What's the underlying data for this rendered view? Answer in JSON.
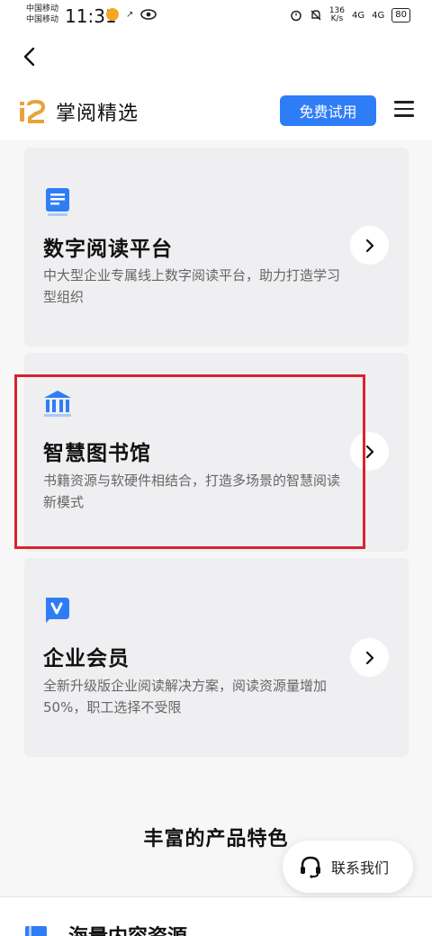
{
  "status_bar": {
    "carrier_1": "中国移动",
    "carrier_2": "中国移动",
    "time": "11:31",
    "net_speed_value": "136",
    "net_speed_unit": "K/s",
    "signal_1": "4G",
    "signal_2": "4G",
    "battery": "80"
  },
  "header": {
    "brand": "掌阅精选",
    "trial_button": "免费试用"
  },
  "cards": [
    {
      "title": "数字阅读平台",
      "description": "中大型企业专属线上数字阅读平台，助力打造学习型组织",
      "icon": "document-icon"
    },
    {
      "title": "智慧图书馆",
      "description": "书籍资源与软硬件相结合，打造多场景的智慧阅读新模式",
      "icon": "library-icon"
    },
    {
      "title": "企业会员",
      "description": "全新升级版企业阅读解决方案，阅读资源量增加50%，职工选择不受限",
      "icon": "vip-icon"
    }
  ],
  "section_title": "丰富的产品特色",
  "contact_button": "联系我们",
  "bottom_card": {
    "title": "海量内容资源"
  },
  "colors": {
    "accent": "#2f7df6",
    "highlight": "#d9232e",
    "card_bg": "#efeff1",
    "logo_orange": "#e8a23a"
  }
}
